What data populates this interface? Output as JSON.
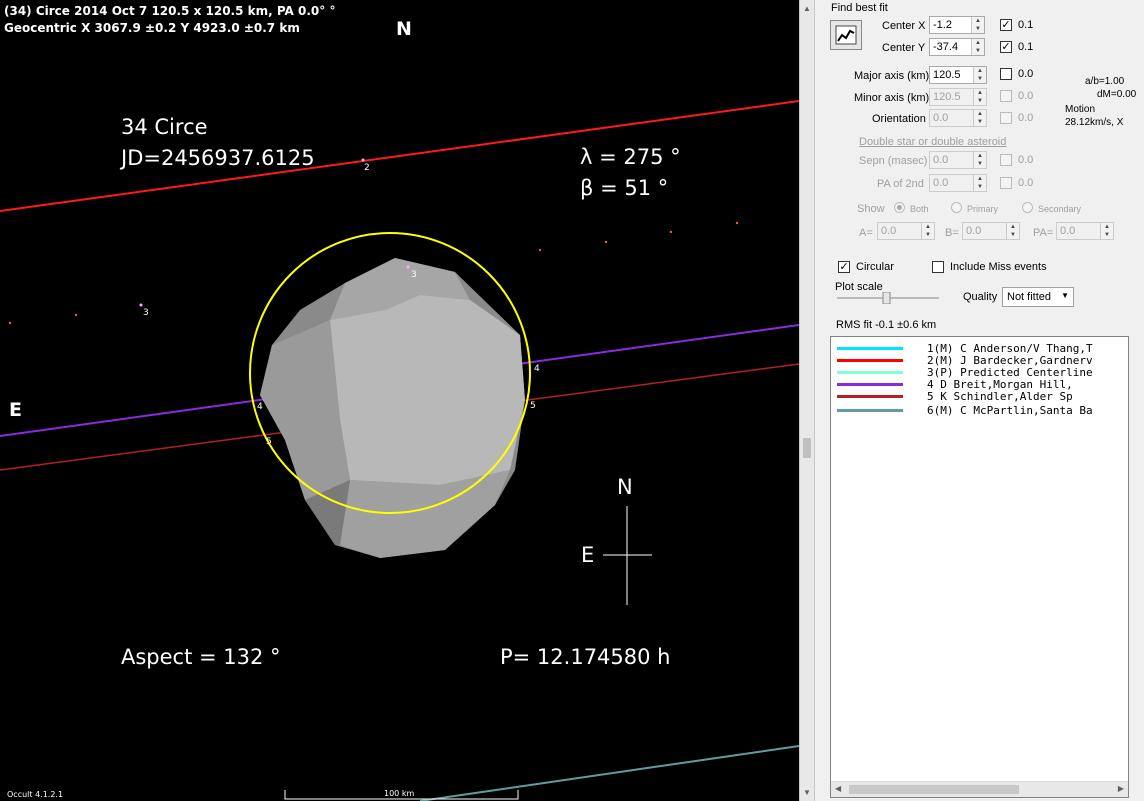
{
  "plot": {
    "header_line1": "(34) Circe  2014 Oct 7  120.5 x 120.5 km, PA 0.0° °",
    "header_line2": "Geocentric  X  3067.9 ±0.2  Y 4923.0 ±0.7 km",
    "north": "N",
    "east": "E",
    "asteroid_name": "34 Circe",
    "jd": "JD=2456937.6125",
    "lambda": "λ =  275 °",
    "beta": "β =   51 °",
    "aspect": "Aspect = 132 °",
    "period": "P= 12.174580 h",
    "compass_n": "N",
    "compass_e": "E",
    "version": "Occult 4.1.2.1",
    "scale_label": "100 km",
    "chord_labels": [
      "2",
      "3",
      "3",
      "4",
      "4",
      "5",
      "5"
    ]
  },
  "panel": {
    "find_best_fit": "Find best fit",
    "center_x_label": "Center X",
    "center_x_value": "-1.2",
    "center_x_step": "0.1",
    "center_y_label": "Center Y",
    "center_y_value": "-37.4",
    "center_y_step": "0.1",
    "major_label": "Major axis (km)",
    "major_value": "120.5",
    "major_step": "0.0",
    "minor_label": "Minor axis (km)",
    "minor_value": "120.5",
    "minor_step": "0.0",
    "orient_label": "Orientation",
    "orient_value": "0.0",
    "orient_step": "0.0",
    "ab": "a/b=1.00",
    "dm": "dM=0.00",
    "motion_label": "Motion",
    "motion_value": "28.12km/s, X",
    "double_star": "Double star  or  double asteroid",
    "sepn_label": "Sepn (masec)",
    "sepn_value": "0.0",
    "sepn_step": "0.0",
    "pa2_label": "PA of 2nd",
    "pa2_value": "0.0",
    "pa2_step": "0.0",
    "show_label": "Show",
    "show_both": "Both",
    "show_primary": "Primary",
    "show_secondary": "Secondary",
    "a_label": "A=",
    "a_value": "0.0",
    "b_label": "B=",
    "b_value": "0.0",
    "pa_label": "PA=",
    "pa_value": "0.0",
    "circular": "Circular",
    "include_miss": "Include Miss events",
    "plot_scale": "Plot scale",
    "quality_label": "Quality",
    "quality_value": "Not fitted",
    "rms": "RMS fit -0.1 ±0.6 km",
    "chords": [
      {
        "text": "1(M)  C Anderson/V Thang,T",
        "color": "#00e5ff"
      },
      {
        "text": "2(M)  J Bardecker,Gardnerv",
        "color": "#ff0000"
      },
      {
        "text": "3(P)  Predicted Centerline",
        "color": "#80ffd8"
      },
      {
        "text": "4     D Breit,Morgan Hill,",
        "color": "#8a2be2"
      },
      {
        "text": "5     K Schindler,Alder Sp",
        "color": "#b22222"
      },
      {
        "text": "6(M)  C McPartlin,Santa Ba",
        "color": "#5f9ea0"
      }
    ]
  }
}
